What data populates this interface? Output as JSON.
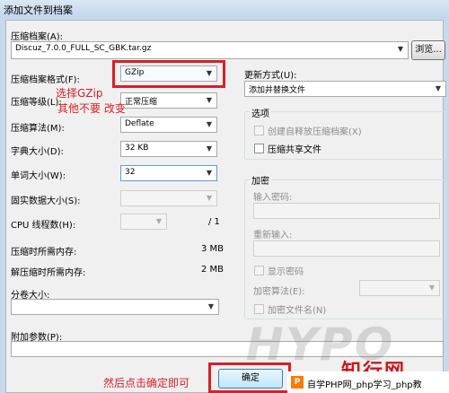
{
  "window": {
    "title": "添加文件到档案"
  },
  "archive": {
    "label": "压缩档案(A):",
    "path": "Discuz_7.0.0_FULL_SC_GBK.tar.gz",
    "browse_label": "浏览..."
  },
  "left": {
    "format": {
      "label": "压缩档案格式(F):",
      "value": "GZip"
    },
    "level": {
      "label": "压缩等级(L):",
      "value": "正常压缩"
    },
    "method": {
      "label": "压缩算法(M):",
      "value": "Deflate"
    },
    "dict": {
      "label": "字典大小(D):",
      "value": "32 KB"
    },
    "word": {
      "label": "单词大小(W):",
      "value": "32"
    },
    "solid": {
      "label": "固实数据大小(S):",
      "value": ""
    },
    "cpu": {
      "label": "CPU 线程数(H):",
      "value": "",
      "total": "/ 1"
    },
    "mem_compress": {
      "label": "压缩时所需内存:",
      "value": "3 MB"
    },
    "mem_decompress": {
      "label": "解压缩时所需内存:",
      "value": "2 MB"
    },
    "split": {
      "label": "分卷大小:",
      "value": ""
    },
    "params": {
      "label": "附加参数(P):",
      "value": ""
    }
  },
  "right": {
    "update": {
      "label": "更新方式(U):",
      "value": "添加并替换文件"
    },
    "options": {
      "title": "选项",
      "sfx": "创建自释放压缩档案(X)",
      "shared": "压缩共享文件"
    },
    "encrypt": {
      "title": "加密",
      "password_label": "输入密码:",
      "reenter_label": "重新输入:",
      "show_password": "显示密码",
      "method_label": "加密算法(E):",
      "encrypt_names": "加密文件名(N)"
    }
  },
  "buttons": {
    "ok": "确定"
  },
  "annotations": {
    "select_gzip": "选择GZip",
    "others_unchanged": "其他不要 改变",
    "click_ok": "然后点击确定即可"
  },
  "branding": {
    "watermark": "HYPO",
    "logo": "知行网",
    "footer": "自学PHP网_php学习_php教",
    "badge": "P"
  },
  "colors": {
    "annotation_red": "#d72028"
  }
}
